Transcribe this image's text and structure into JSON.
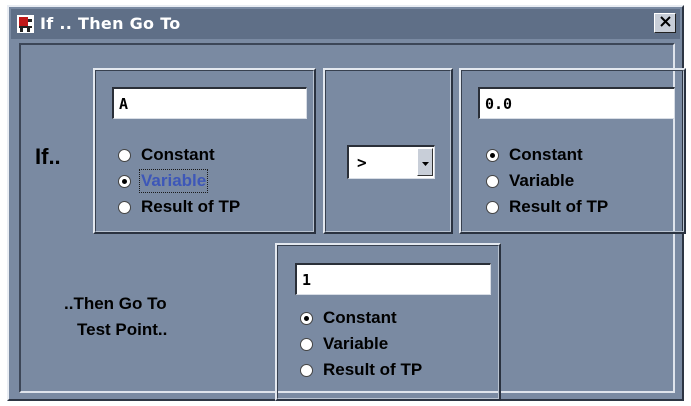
{
  "window": {
    "title": "If .. Then Go To"
  },
  "if_label": "If..",
  "left_operand": {
    "value": "A",
    "options": [
      "Constant",
      "Variable",
      "Result of TP"
    ],
    "selected": "Variable"
  },
  "operator": {
    "value": ">"
  },
  "right_operand": {
    "value": "0.0",
    "options": [
      "Constant",
      "Variable",
      "Result of TP"
    ],
    "selected": "Constant"
  },
  "then_label_line1": "..Then Go To",
  "then_label_line2": "Test Point..",
  "target": {
    "value": "1",
    "options": [
      "Constant",
      "Variable",
      "Result of TP"
    ],
    "selected": "Constant"
  },
  "icons": {
    "app": "test-icon",
    "close": "close-icon",
    "dropdown": "chevron-down-icon"
  }
}
